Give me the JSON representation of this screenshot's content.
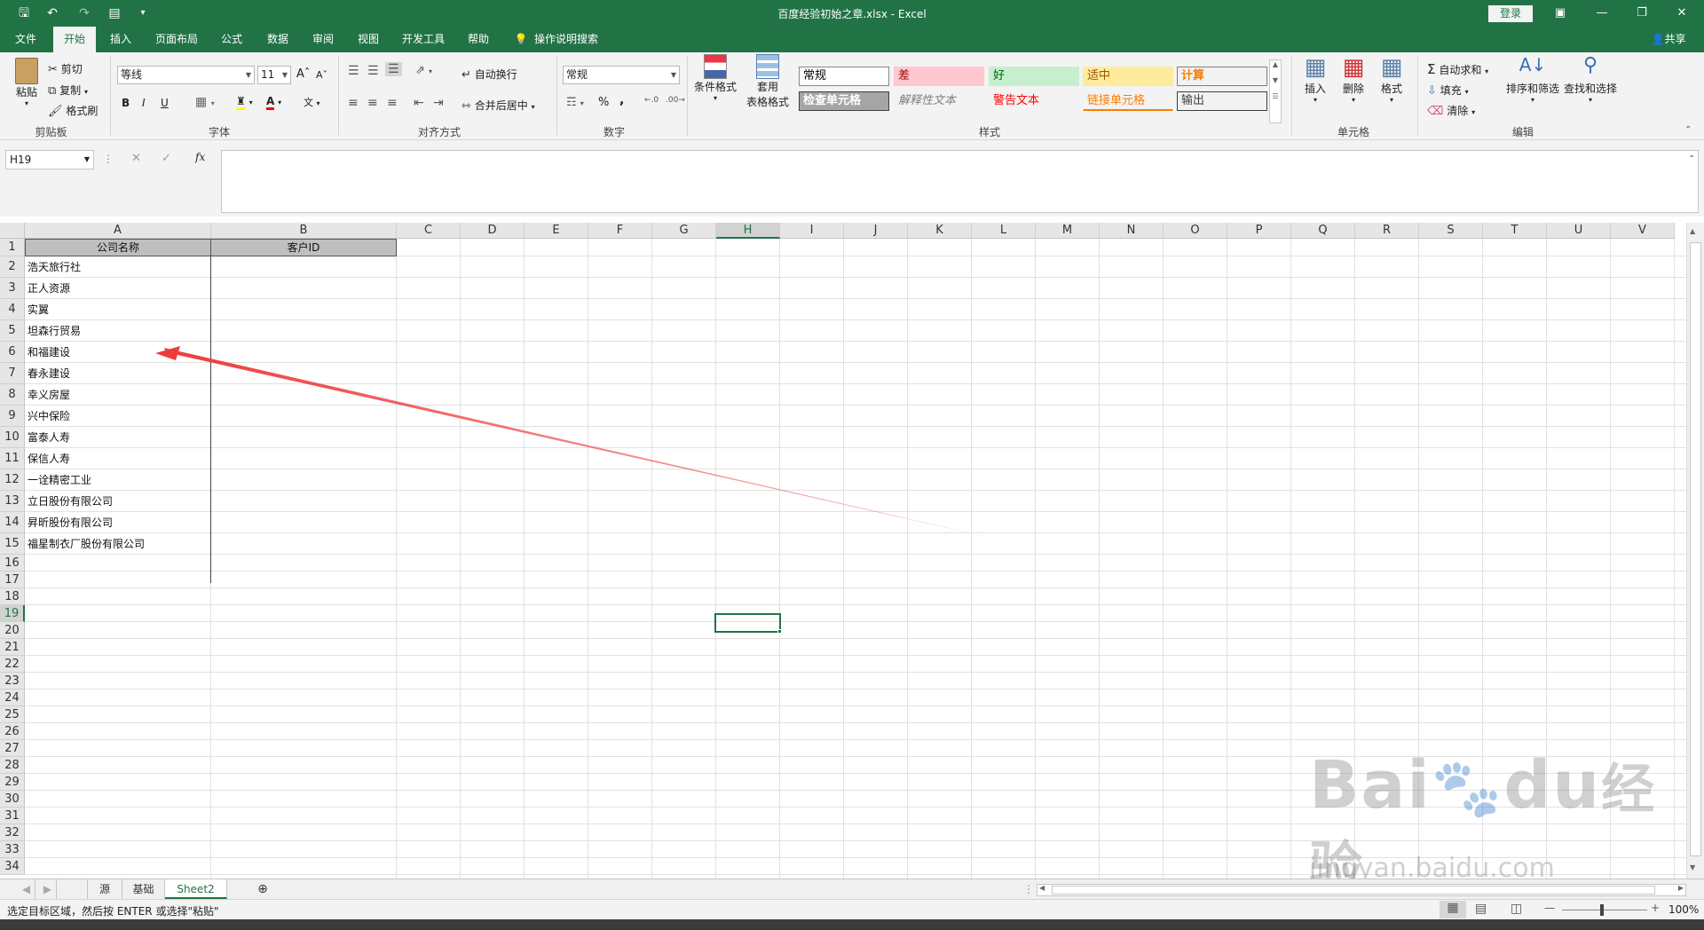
{
  "window": {
    "title": "百度经验初始之章.xlsx - Excel",
    "login": "登录"
  },
  "tabs": [
    "文件",
    "开始",
    "插入",
    "页面布局",
    "公式",
    "数据",
    "审阅",
    "视图",
    "开发工具",
    "帮助"
  ],
  "active_tab": "开始",
  "tell_me": "操作说明搜索",
  "share": "共享",
  "ribbon": {
    "clipboard": {
      "label": "剪贴板",
      "paste": "粘贴",
      "cut": "剪切",
      "copy": "复制",
      "format_painter": "格式刷"
    },
    "font": {
      "label": "字体",
      "name": "等线",
      "size": "11",
      "bold": "B",
      "italic": "I",
      "underline": "U"
    },
    "alignment": {
      "label": "对齐方式",
      "wrap": "自动换行",
      "merge": "合并后居中"
    },
    "number": {
      "label": "数字",
      "format": "常规",
      "percent": "%",
      "comma": ","
    },
    "styles": {
      "label": "样式",
      "conditional": "条件格式",
      "table1": "套用",
      "table2": "表格格式",
      "cells": [
        {
          "text": "常规",
          "bg": "#ffffff",
          "fg": "#000000",
          "border": "#888888"
        },
        {
          "text": "差",
          "bg": "#ffc7ce",
          "fg": "#9c0006",
          "border": "#ffc7ce"
        },
        {
          "text": "好",
          "bg": "#c6efce",
          "fg": "#006100",
          "border": "#c6efce"
        },
        {
          "text": "适中",
          "bg": "#ffeb9c",
          "fg": "#9c5700",
          "border": "#ffeb9c"
        },
        {
          "text": "计算",
          "bg": "#f2f2f2",
          "fg": "#fa7d00",
          "border": "#7f7f7f"
        },
        {
          "text": "检查单元格",
          "bg": "#a5a5a5",
          "fg": "#ffffff",
          "border": "#3f3f3f"
        },
        {
          "text": "解释性文本",
          "bg": "#f3f3f3",
          "fg": "#7f7f7f",
          "border": "#f3f3f3"
        },
        {
          "text": "警告文本",
          "bg": "#f3f3f3",
          "fg": "#ff0000",
          "border": "#f3f3f3"
        },
        {
          "text": "链接单元格",
          "bg": "#f3f3f3",
          "fg": "#fa7d00",
          "border": "#f3f3f3"
        },
        {
          "text": "输出",
          "bg": "#f2f2f2",
          "fg": "#3f3f3f",
          "border": "#3f3f3f"
        }
      ]
    },
    "cells": {
      "label": "单元格",
      "insert": "插入",
      "delete": "删除",
      "format": "格式"
    },
    "editing": {
      "label": "编辑",
      "autosum": "自动求和",
      "fill": "填充",
      "clear": "清除",
      "sort": "排序和筛选",
      "find": "查找和选择"
    }
  },
  "formula_bar": {
    "name_box": "H19",
    "fx": "fx",
    "value": ""
  },
  "columns": [
    "A",
    "B",
    "C",
    "D",
    "E",
    "F",
    "G",
    "H",
    "I",
    "J",
    "K",
    "L",
    "M",
    "N",
    "O",
    "P",
    "Q",
    "R",
    "S",
    "T",
    "U",
    "V"
  ],
  "selected_col": "H",
  "selected_row": "19",
  "rows": [
    "1",
    "2",
    "3",
    "4",
    "5",
    "6",
    "7",
    "8",
    "9",
    "10",
    "11",
    "12",
    "13",
    "14",
    "15",
    "16",
    "17",
    "18",
    "19",
    "20",
    "21",
    "22",
    "23",
    "24",
    "25",
    "26",
    "27",
    "28",
    "29",
    "30",
    "31",
    "32",
    "33",
    "34"
  ],
  "headers": {
    "a1": "公司名称",
    "b1": "客户ID"
  },
  "companies": [
    "浩天旅行社",
    "正人资源",
    "实翼",
    "坦森行贸易",
    "和福建设",
    "春永建设",
    "幸义房屋",
    "兴中保险",
    "富泰人寿",
    "保信人寿",
    "一诠精密工业",
    "立日股份有限公司",
    "昇昕股份有限公司",
    "福星制衣厂股份有限公司"
  ],
  "sheets": [
    "源",
    "基础",
    "Sheet2"
  ],
  "active_sheet": "Sheet2",
  "status_text": "选定目标区域，然后按 ENTER 或选择\"粘贴\"",
  "zoom": "100%",
  "arrow_color": "#ee3b3b",
  "watermark": {
    "brand": "Bai",
    "brand2": "du",
    "cn": "经验",
    "url": "jingyan.baidu.com"
  }
}
